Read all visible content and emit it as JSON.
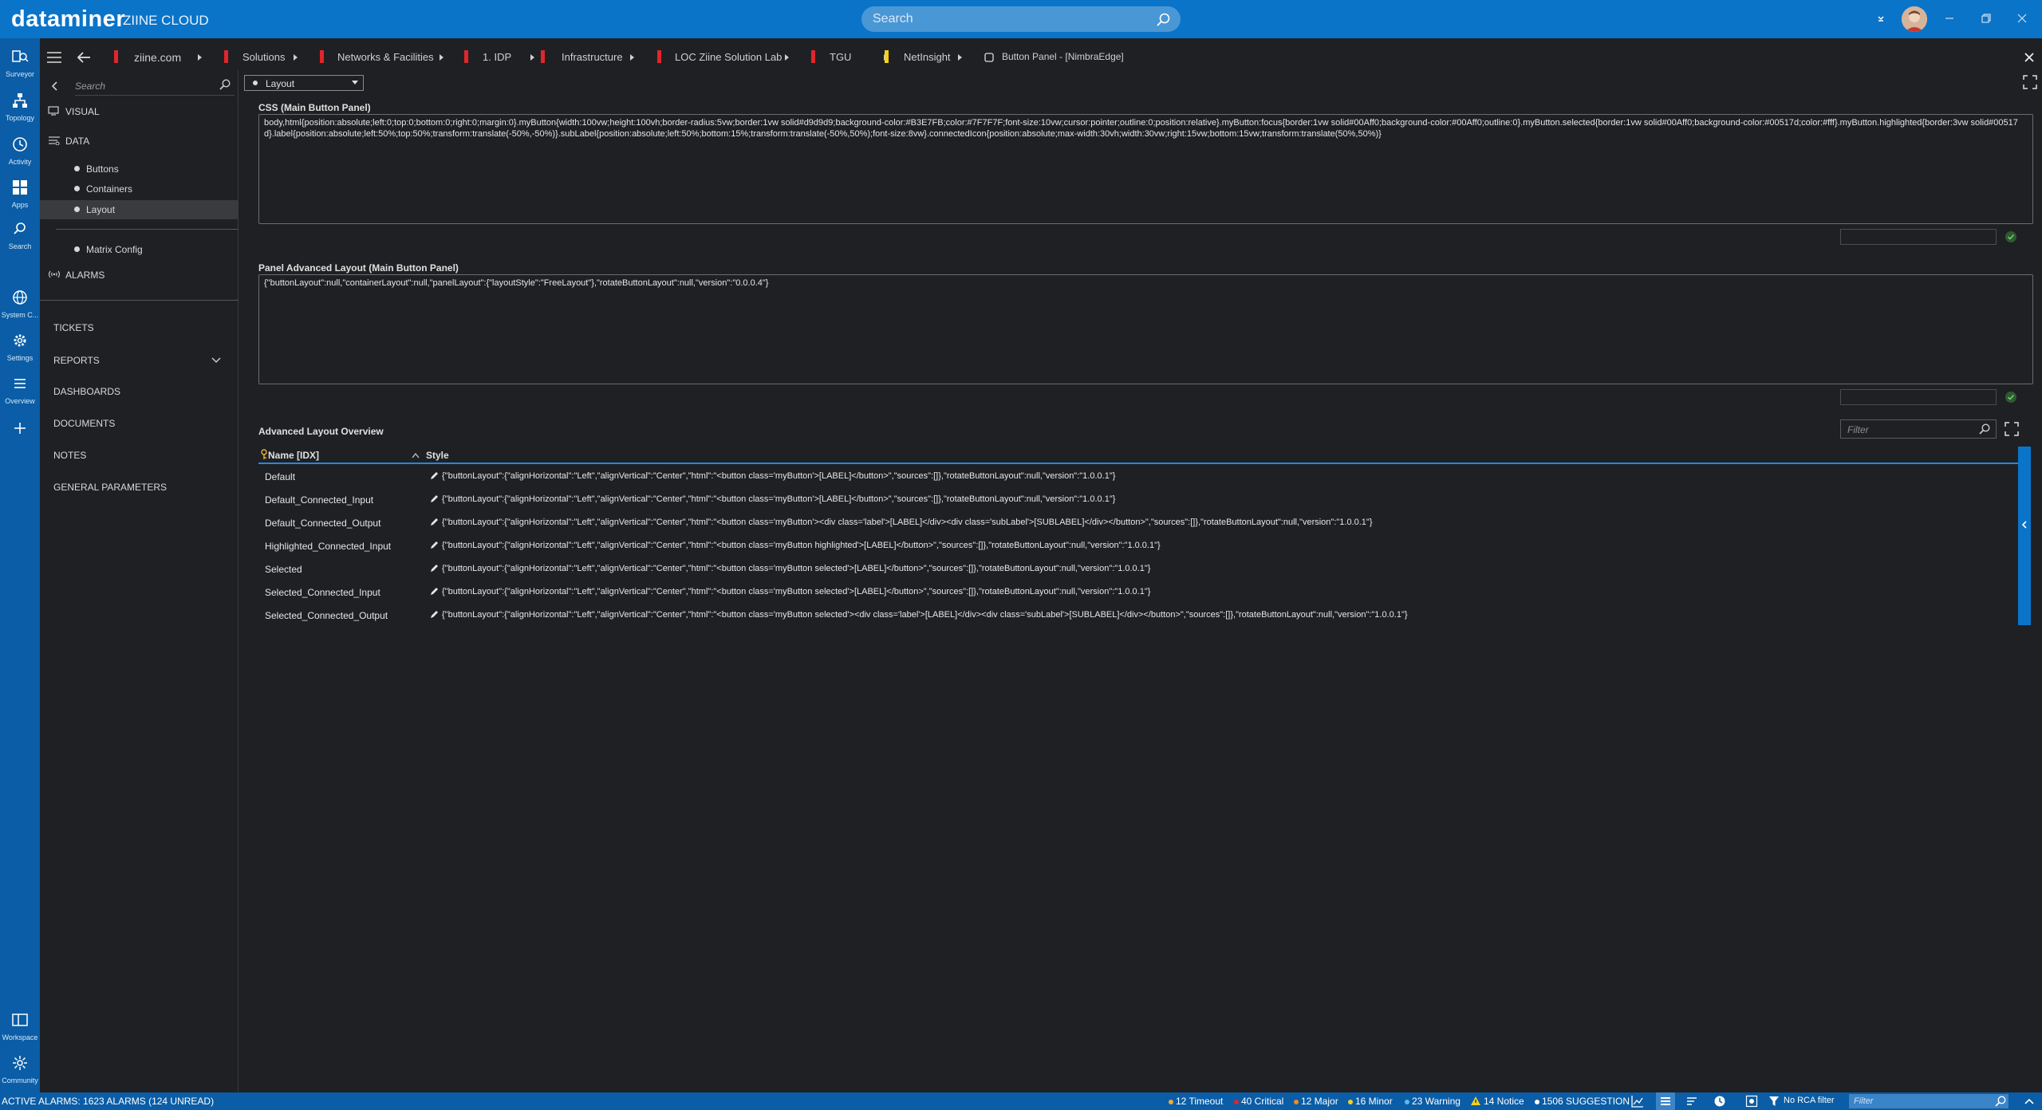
{
  "app": {
    "logo": "dataminer",
    "system_name": "ZIINE CLOUD"
  },
  "top_search": {
    "placeholder": "Search"
  },
  "rail": [
    {
      "label": "Surveyor",
      "icon": "surveyor-icon"
    },
    {
      "label": "Topology",
      "icon": "topology-icon"
    },
    {
      "label": "Activity",
      "icon": "activity-icon"
    },
    {
      "label": "Apps",
      "icon": "apps-icon"
    },
    {
      "label": "Search",
      "icon": "search-icon"
    },
    {
      "label": "System C...",
      "icon": "globe-icon"
    },
    {
      "label": "Settings",
      "icon": "gear-icon"
    },
    {
      "label": "Overview",
      "icon": "list-icon"
    },
    {
      "label": "Workspace",
      "icon": "workspace-icon"
    },
    {
      "label": "Community",
      "icon": "community-icon"
    }
  ],
  "breadcrumb": [
    {
      "label": "ziine.com",
      "color": "#e0262a"
    },
    {
      "label": "Solutions",
      "color": "#e0262a"
    },
    {
      "label": "Networks & Facilities",
      "color": "#e0262a"
    },
    {
      "label": "1. IDP",
      "color": "#e0262a"
    },
    {
      "label": "Infrastructure",
      "color": "#e0262a"
    },
    {
      "label": "LOC Ziine Solution Lab",
      "color": "#e0262a"
    },
    {
      "label": "TGU",
      "color": "#e0262a"
    },
    {
      "label": "NetInsight",
      "color": "#f2d21b"
    },
    {
      "label": "Button Panel - [NimbraEdge]",
      "color": ""
    }
  ],
  "leftnav": {
    "search_placeholder": "Search",
    "visual": "VISUAL",
    "data": "DATA",
    "data_items": [
      "Buttons",
      "Containers",
      "Layout"
    ],
    "matrix_config": "Matrix Config",
    "alarms": "ALARMS",
    "tickets": "TICKETS",
    "reports": "REPORTS",
    "dashboards": "DASHBOARDS",
    "documents": "DOCUMENTS",
    "notes": "NOTES",
    "general_parameters": "GENERAL PARAMETERS"
  },
  "main": {
    "dropdown_value": "Layout",
    "css_title": "CSS (Main Button Panel)",
    "css_value": "body,html{position:absolute;left:0;top:0;bottom:0;right:0;margin:0}.myButton{width:100vw;height:100vh;border-radius:5vw;border:1vw solid#d9d9d9;background-color:#B3E7FB;color:#7F7F7F;font-size:10vw;cursor:pointer;outline:0;position:relative}.myButton:focus{border:1vw solid#00Aff0;background-color:#00Aff0;outline:0}.myButton.selected{border:1vw solid#00Aff0;background-color:#00517d;color:#fff}.myButton.highlighted{border:3vw solid#00517d}.label{position:absolute;left:50%;top:50%;transform:translate(-50%,-50%)}.subLabel{position:absolute;left:50%;bottom:15%;transform:translate(-50%,50%);font-size:8vw}.connectedIcon{position:absolute;max-width:30vh;width:30vw;right:15vw;bottom:15vw;transform:translate(50%,50%)}",
    "panel_title": "Panel Advanced Layout (Main Button Panel)",
    "panel_value": "{\"buttonLayout\":null,\"containerLayout\":null,\"panelLayout\":{\"layoutStyle\":\"FreeLayout\"},\"rotateButtonLayout\":null,\"version\":\"0.0.0.4\"}",
    "overview_title": "Advanced Layout Overview",
    "filter_placeholder": "Filter",
    "columns": [
      "Name [IDX]",
      "Style"
    ],
    "rows": [
      {
        "name": "Default",
        "style": "{\"buttonLayout\":{\"alignHorizontal\":\"Left\",\"alignVertical\":\"Center\",\"html\":\"<button class='myButton'>[LABEL]</button>\",\"sources\":[]},\"rotateButtonLayout\":null,\"version\":\"1.0.0.1\"}"
      },
      {
        "name": "Default_Connected_Input",
        "style": "{\"buttonLayout\":{\"alignHorizontal\":\"Left\",\"alignVertical\":\"Center\",\"html\":\"<button class='myButton'>[LABEL]</button>\",\"sources\":[]},\"rotateButtonLayout\":null,\"version\":\"1.0.0.1\"}"
      },
      {
        "name": "Default_Connected_Output",
        "style": "{\"buttonLayout\":{\"alignHorizontal\":\"Left\",\"alignVertical\":\"Center\",\"html\":\"<button class='myButton'><div class='label'>[LABEL]</div><div class='subLabel'>[SUBLABEL]</div></button>\",\"sources\":[]},\"rotateButtonLayout\":null,\"version\":\"1.0.0.1\"}"
      },
      {
        "name": "Highlighted_Connected_Input",
        "style": "{\"buttonLayout\":{\"alignHorizontal\":\"Left\",\"alignVertical\":\"Center\",\"html\":\"<button class='myButton highlighted'>[LABEL]</button>\",\"sources\":[]},\"rotateButtonLayout\":null,\"version\":\"1.0.0.1\"}"
      },
      {
        "name": "Selected",
        "style": "{\"buttonLayout\":{\"alignHorizontal\":\"Left\",\"alignVertical\":\"Center\",\"html\":\"<button class='myButton selected'>[LABEL]</button>\",\"sources\":[]},\"rotateButtonLayout\":null,\"version\":\"1.0.0.1\"}"
      },
      {
        "name": "Selected_Connected_Input",
        "style": "{\"buttonLayout\":{\"alignHorizontal\":\"Left\",\"alignVertical\":\"Center\",\"html\":\"<button class='myButton selected'>[LABEL]</button>\",\"sources\":[]},\"rotateButtonLayout\":null,\"version\":\"1.0.0.1\"}"
      },
      {
        "name": "Selected_Connected_Output",
        "style": "{\"buttonLayout\":{\"alignHorizontal\":\"Left\",\"alignVertical\":\"Center\",\"html\":\"<button class='myButton selected'><div class='label'>[LABEL]</div><div class='subLabel'>[SUBLABEL]</div></button>\",\"sources\":[]},\"rotateButtonLayout\":null,\"version\":\"1.0.0.1\"}"
      }
    ]
  },
  "status": {
    "active_alarms": "ACTIVE ALARMS: 1623 ALARMS (124 UNREAD)",
    "timeout": "12 Timeout",
    "critical": "40 Critical",
    "major": "12 Major",
    "minor": "16 Minor",
    "warning": "23 Warning",
    "notice": "14 Notice",
    "suggestion": "1506 SUGGESTION",
    "rca": "No RCA filter",
    "filter_placeholder": "Filter"
  },
  "colors": {
    "accent": "#0a74c9",
    "timeout": "#f0a93a",
    "critical": "#e0262a",
    "major": "#f08c1e",
    "minor": "#f2d21b",
    "warning": "#5fb8e8",
    "notice": "#f2d21b",
    "suggestion": "#ffffff"
  }
}
